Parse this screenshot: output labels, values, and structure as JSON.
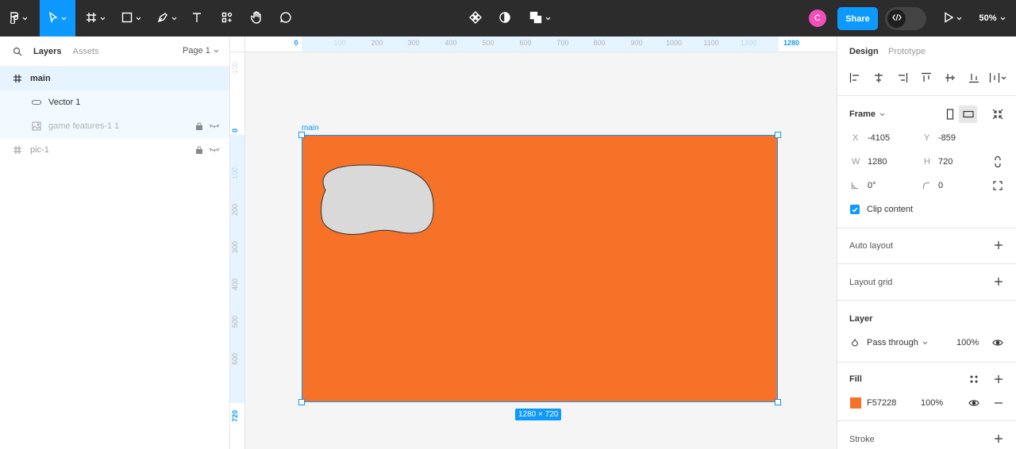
{
  "toolbar": {
    "share_label": "Share",
    "zoom_label": "50%",
    "user_initial": "C",
    "accent": "#0d99ff",
    "avatar_color": "#f24fbd"
  },
  "left_panel": {
    "tabs": [
      "Layers",
      "Assets"
    ],
    "page_label": "Page 1",
    "layers": [
      {
        "name": "main",
        "type": "frame",
        "selected": true
      },
      {
        "name": "Vector 1",
        "type": "vector"
      },
      {
        "name": "game features-1 1",
        "type": "image",
        "locked": true,
        "hidden": true
      },
      {
        "name": "pic-1",
        "type": "frame",
        "locked": true,
        "hidden": true
      }
    ]
  },
  "rulers": {
    "top": [
      "0",
      "100",
      "200",
      "300",
      "400",
      "500",
      "600",
      "700",
      "800",
      "900",
      "1000",
      "1100",
      "1200",
      "1280"
    ],
    "left": [
      "-100",
      "0",
      "100",
      "200",
      "300",
      "400",
      "500",
      "600",
      "720"
    ]
  },
  "canvas": {
    "frame_label": "main",
    "frame_color": "#f57228",
    "size_badge": "1280 × 720"
  },
  "right_panel": {
    "tabs": [
      "Design",
      "Prototype"
    ],
    "frame_title": "Frame",
    "x_label": "X",
    "x_value": "-4105",
    "y_label": "Y",
    "y_value": "-859",
    "w_label": "W",
    "w_value": "1280",
    "h_label": "H",
    "h_value": "720",
    "rotation_value": "0°",
    "radius_value": "0",
    "clip_label": "Clip content",
    "auto_layout": "Auto layout",
    "layout_grid": "Layout grid",
    "layer_title": "Layer",
    "blend_mode": "Pass through",
    "layer_opacity": "100%",
    "fill_title": "Fill",
    "fill_hex": "F57228",
    "fill_opacity": "100%",
    "stroke_title": "Stroke"
  }
}
